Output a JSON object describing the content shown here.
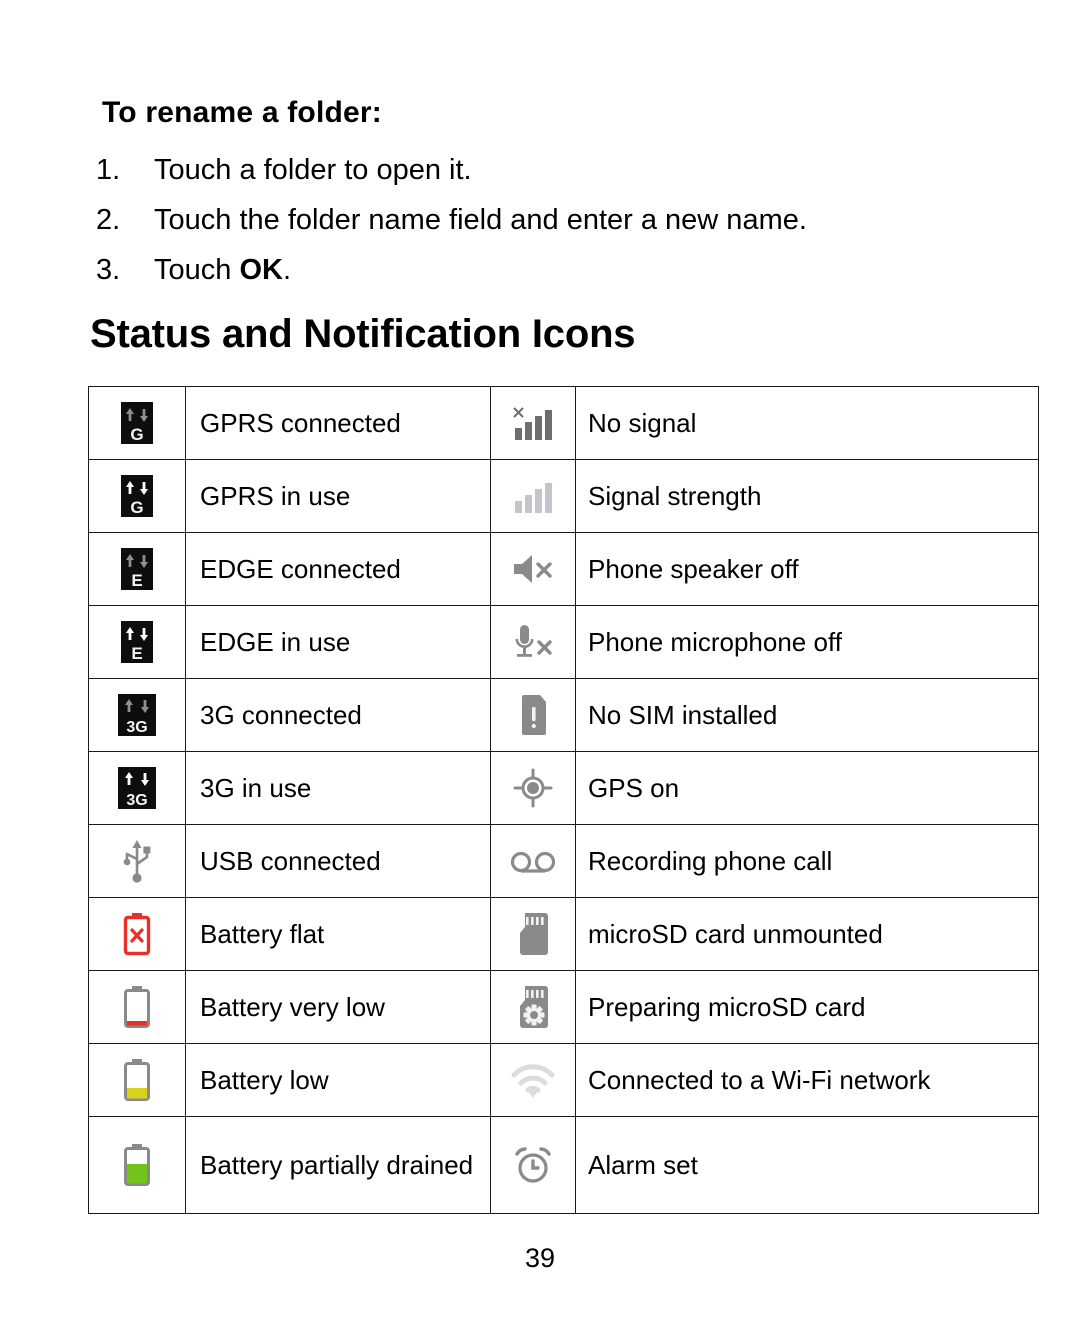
{
  "document": {
    "procedure_heading": "To rename a folder:",
    "steps": [
      {
        "num": "1.",
        "text": "Touch a folder to open it."
      },
      {
        "num": "2.",
        "text": "Touch the folder name field and enter a new name."
      },
      {
        "num": "3.",
        "text": "Touch ",
        "bold": "OK",
        "tail": "."
      }
    ],
    "section_title": "Status and Notification Icons",
    "page_number": "39"
  },
  "colors": {
    "text": "#000000",
    "rule": "#1a1a1a",
    "icon_dark_gray": "#6e6e6e",
    "icon_mid_gray": "#8a8a8a",
    "icon_light_gray": "#c2c6cc",
    "icon_faint_gray": "#dcdcdc",
    "badge_black": "#0d0d0d",
    "badge_arrow_dim": "#8f8f8f",
    "badge_arrow_bright": "#ffffff",
    "battery_red": "#e8302a",
    "battery_yellow": "#d9d21a",
    "battery_green": "#73c41a",
    "battery_outline": "#8a8a8a"
  },
  "table": {
    "rows": [
      {
        "left": {
          "icon": "gprs-connected-icon",
          "label": "GPRS connected"
        },
        "right": {
          "icon": "no-signal-icon",
          "label": "No signal"
        }
      },
      {
        "left": {
          "icon": "gprs-in-use-icon",
          "label": "GPRS in use"
        },
        "right": {
          "icon": "signal-strength-icon",
          "label": "Signal strength"
        }
      },
      {
        "left": {
          "icon": "edge-connected-icon",
          "label": "EDGE connected"
        },
        "right": {
          "icon": "speaker-off-icon",
          "label": "Phone speaker off"
        }
      },
      {
        "left": {
          "icon": "edge-in-use-icon",
          "label": "EDGE in use"
        },
        "right": {
          "icon": "microphone-off-icon",
          "label": "Phone microphone off"
        }
      },
      {
        "left": {
          "icon": "3g-connected-icon",
          "label": "3G connected"
        },
        "right": {
          "icon": "no-sim-icon",
          "label": "No SIM installed"
        }
      },
      {
        "left": {
          "icon": "3g-in-use-icon",
          "label": "3G in use"
        },
        "right": {
          "icon": "gps-on-icon",
          "label": "GPS on"
        }
      },
      {
        "left": {
          "icon": "usb-icon",
          "label": "USB connected"
        },
        "right": {
          "icon": "call-recording-icon",
          "label": "Recording phone call"
        }
      },
      {
        "left": {
          "icon": "battery-flat-icon",
          "label": "Battery flat"
        },
        "right": {
          "icon": "microsd-card-icon",
          "label": "microSD card unmounted"
        }
      },
      {
        "left": {
          "icon": "battery-very-low-icon",
          "label": "Battery very low"
        },
        "right": {
          "icon": "microsd-preparing-icon",
          "label": "Preparing microSD card"
        }
      },
      {
        "left": {
          "icon": "battery-low-icon",
          "label": "Battery low"
        },
        "right": {
          "icon": "wifi-icon",
          "label": "Connected to a Wi-Fi network"
        }
      },
      {
        "left": {
          "icon": "battery-partial-icon",
          "label": "Battery partially drained"
        },
        "right": {
          "icon": "alarm-clock-icon",
          "label": "Alarm set"
        }
      }
    ]
  }
}
